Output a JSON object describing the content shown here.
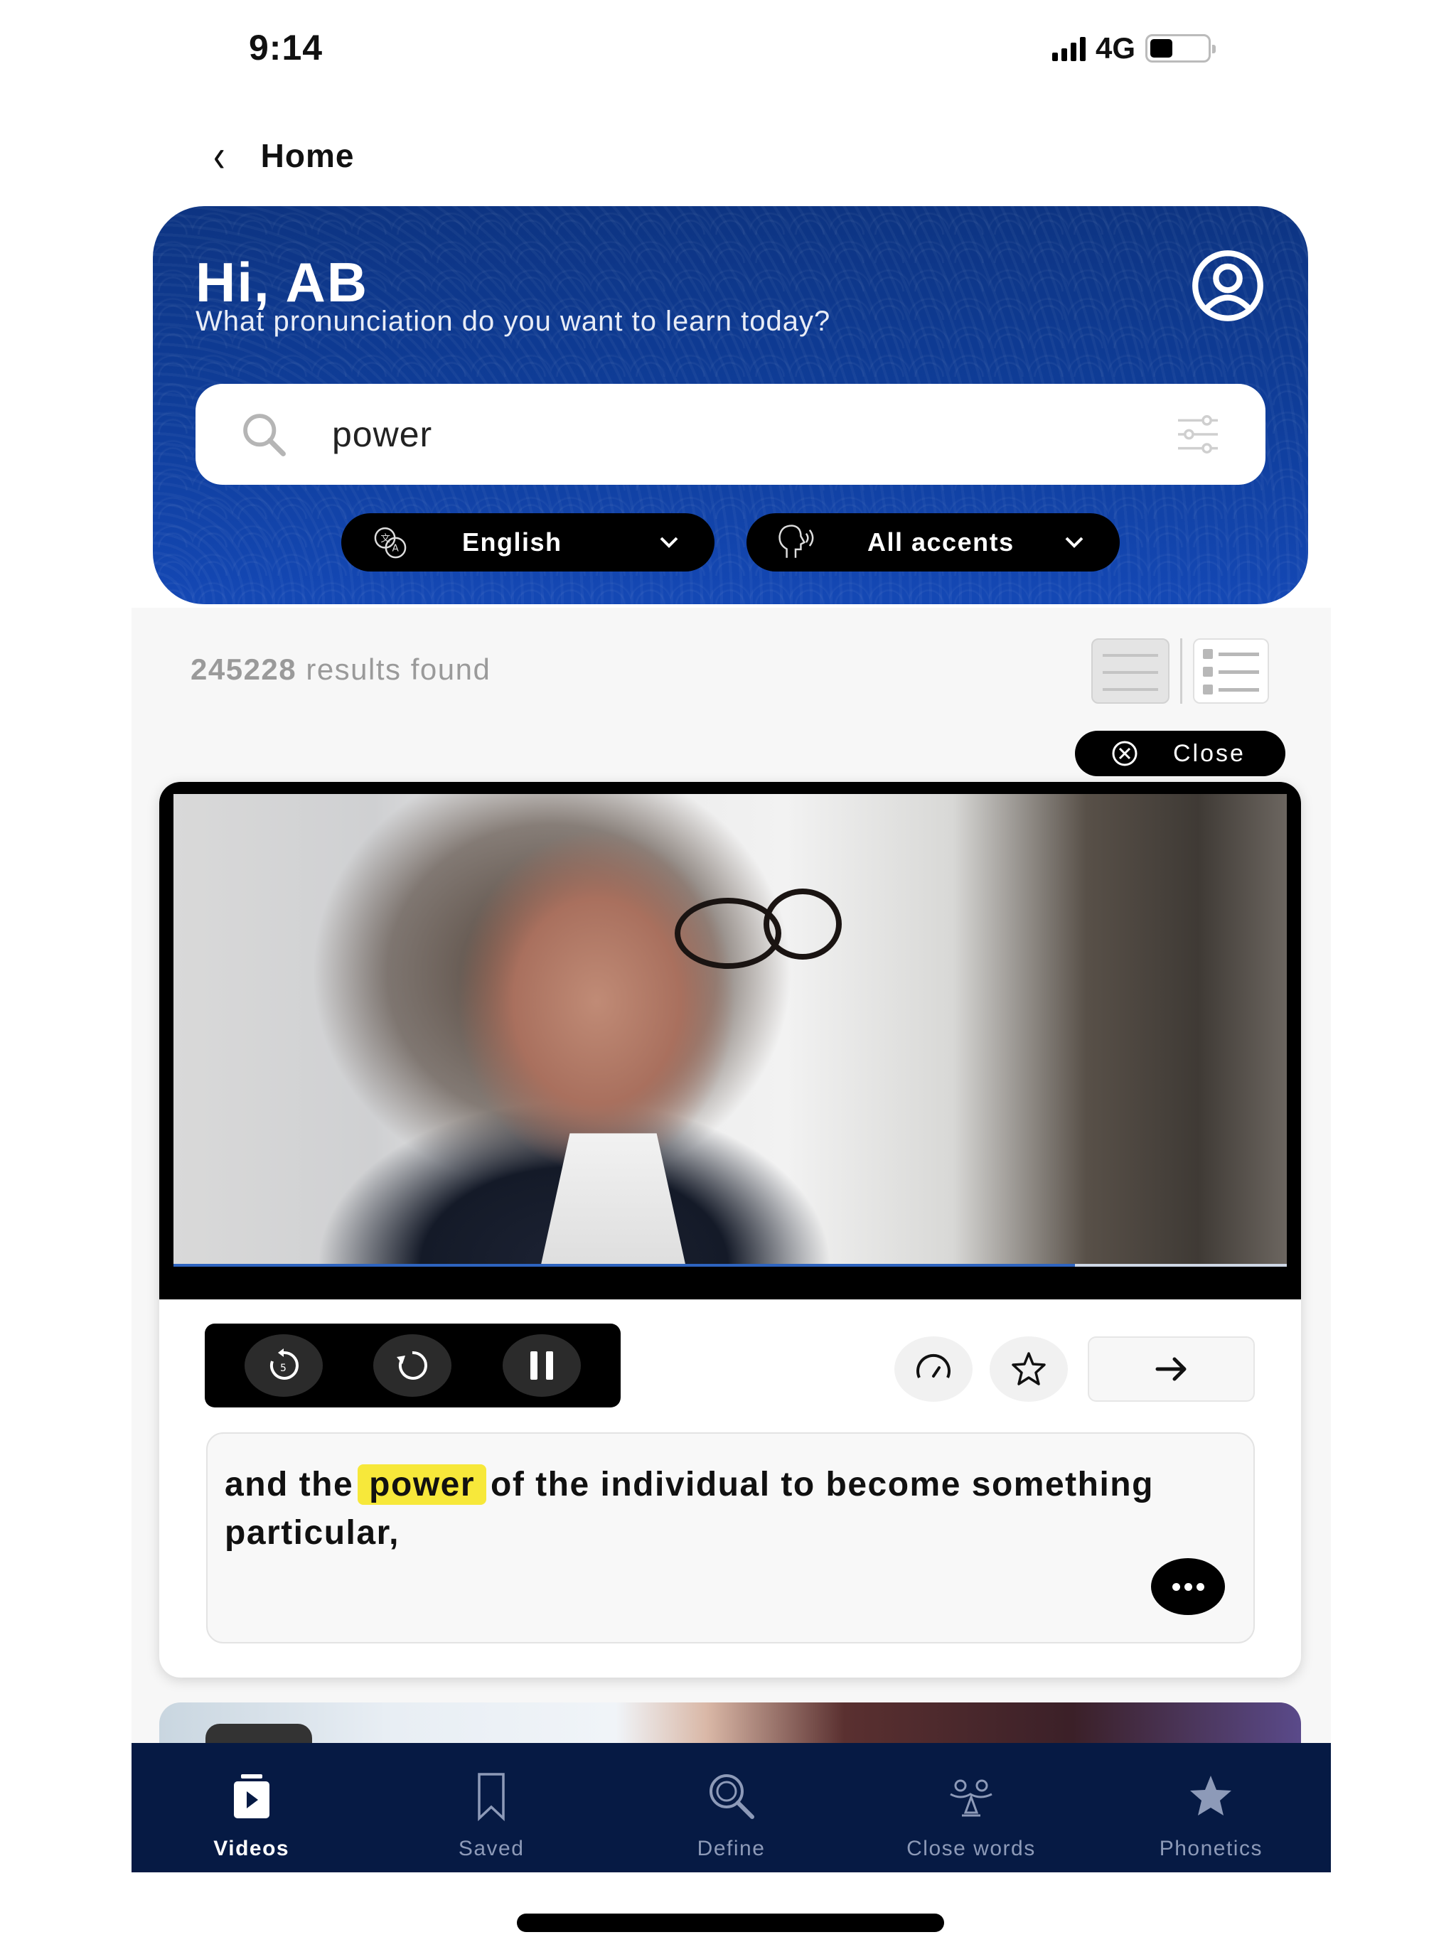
{
  "status_bar": {
    "time": "9:14",
    "network": "4G",
    "signal_bars": 4,
    "battery_level": 0.4
  },
  "nav": {
    "back_label": "Home"
  },
  "header": {
    "greeting": "Hi, AB",
    "subtitle": "What pronunciation do you want to learn today?",
    "search": {
      "value": "power",
      "placeholder": ""
    },
    "language_dropdown": {
      "selected": "English"
    },
    "accent_dropdown": {
      "selected": "All accents"
    },
    "brand_color": "#0f3d99"
  },
  "results": {
    "count": "245228",
    "count_suffix": "results found",
    "view_modes": [
      "grid",
      "list"
    ]
  },
  "player": {
    "close_label": "Close",
    "progress": 0.81,
    "controls": {
      "rewind_5": "rewind-5-seconds",
      "replay": "replay",
      "pause": "pause"
    },
    "actions": [
      "speed",
      "favorite",
      "next"
    ],
    "caption": {
      "before": "and the",
      "highlight": "power",
      "after": "of the individual to become something particular,"
    },
    "highlight_color": "#f7e83a"
  },
  "bottom_nav": {
    "items": [
      {
        "label": "Videos",
        "icon": "video-icon",
        "active": true
      },
      {
        "label": "Saved",
        "icon": "bookmark-icon",
        "active": false
      },
      {
        "label": "Define",
        "icon": "magnifier-icon",
        "active": false
      },
      {
        "label": "Close words",
        "icon": "close-words-icon",
        "active": false
      },
      {
        "label": "Phonetics",
        "icon": "star-icon",
        "active": false
      }
    ]
  }
}
